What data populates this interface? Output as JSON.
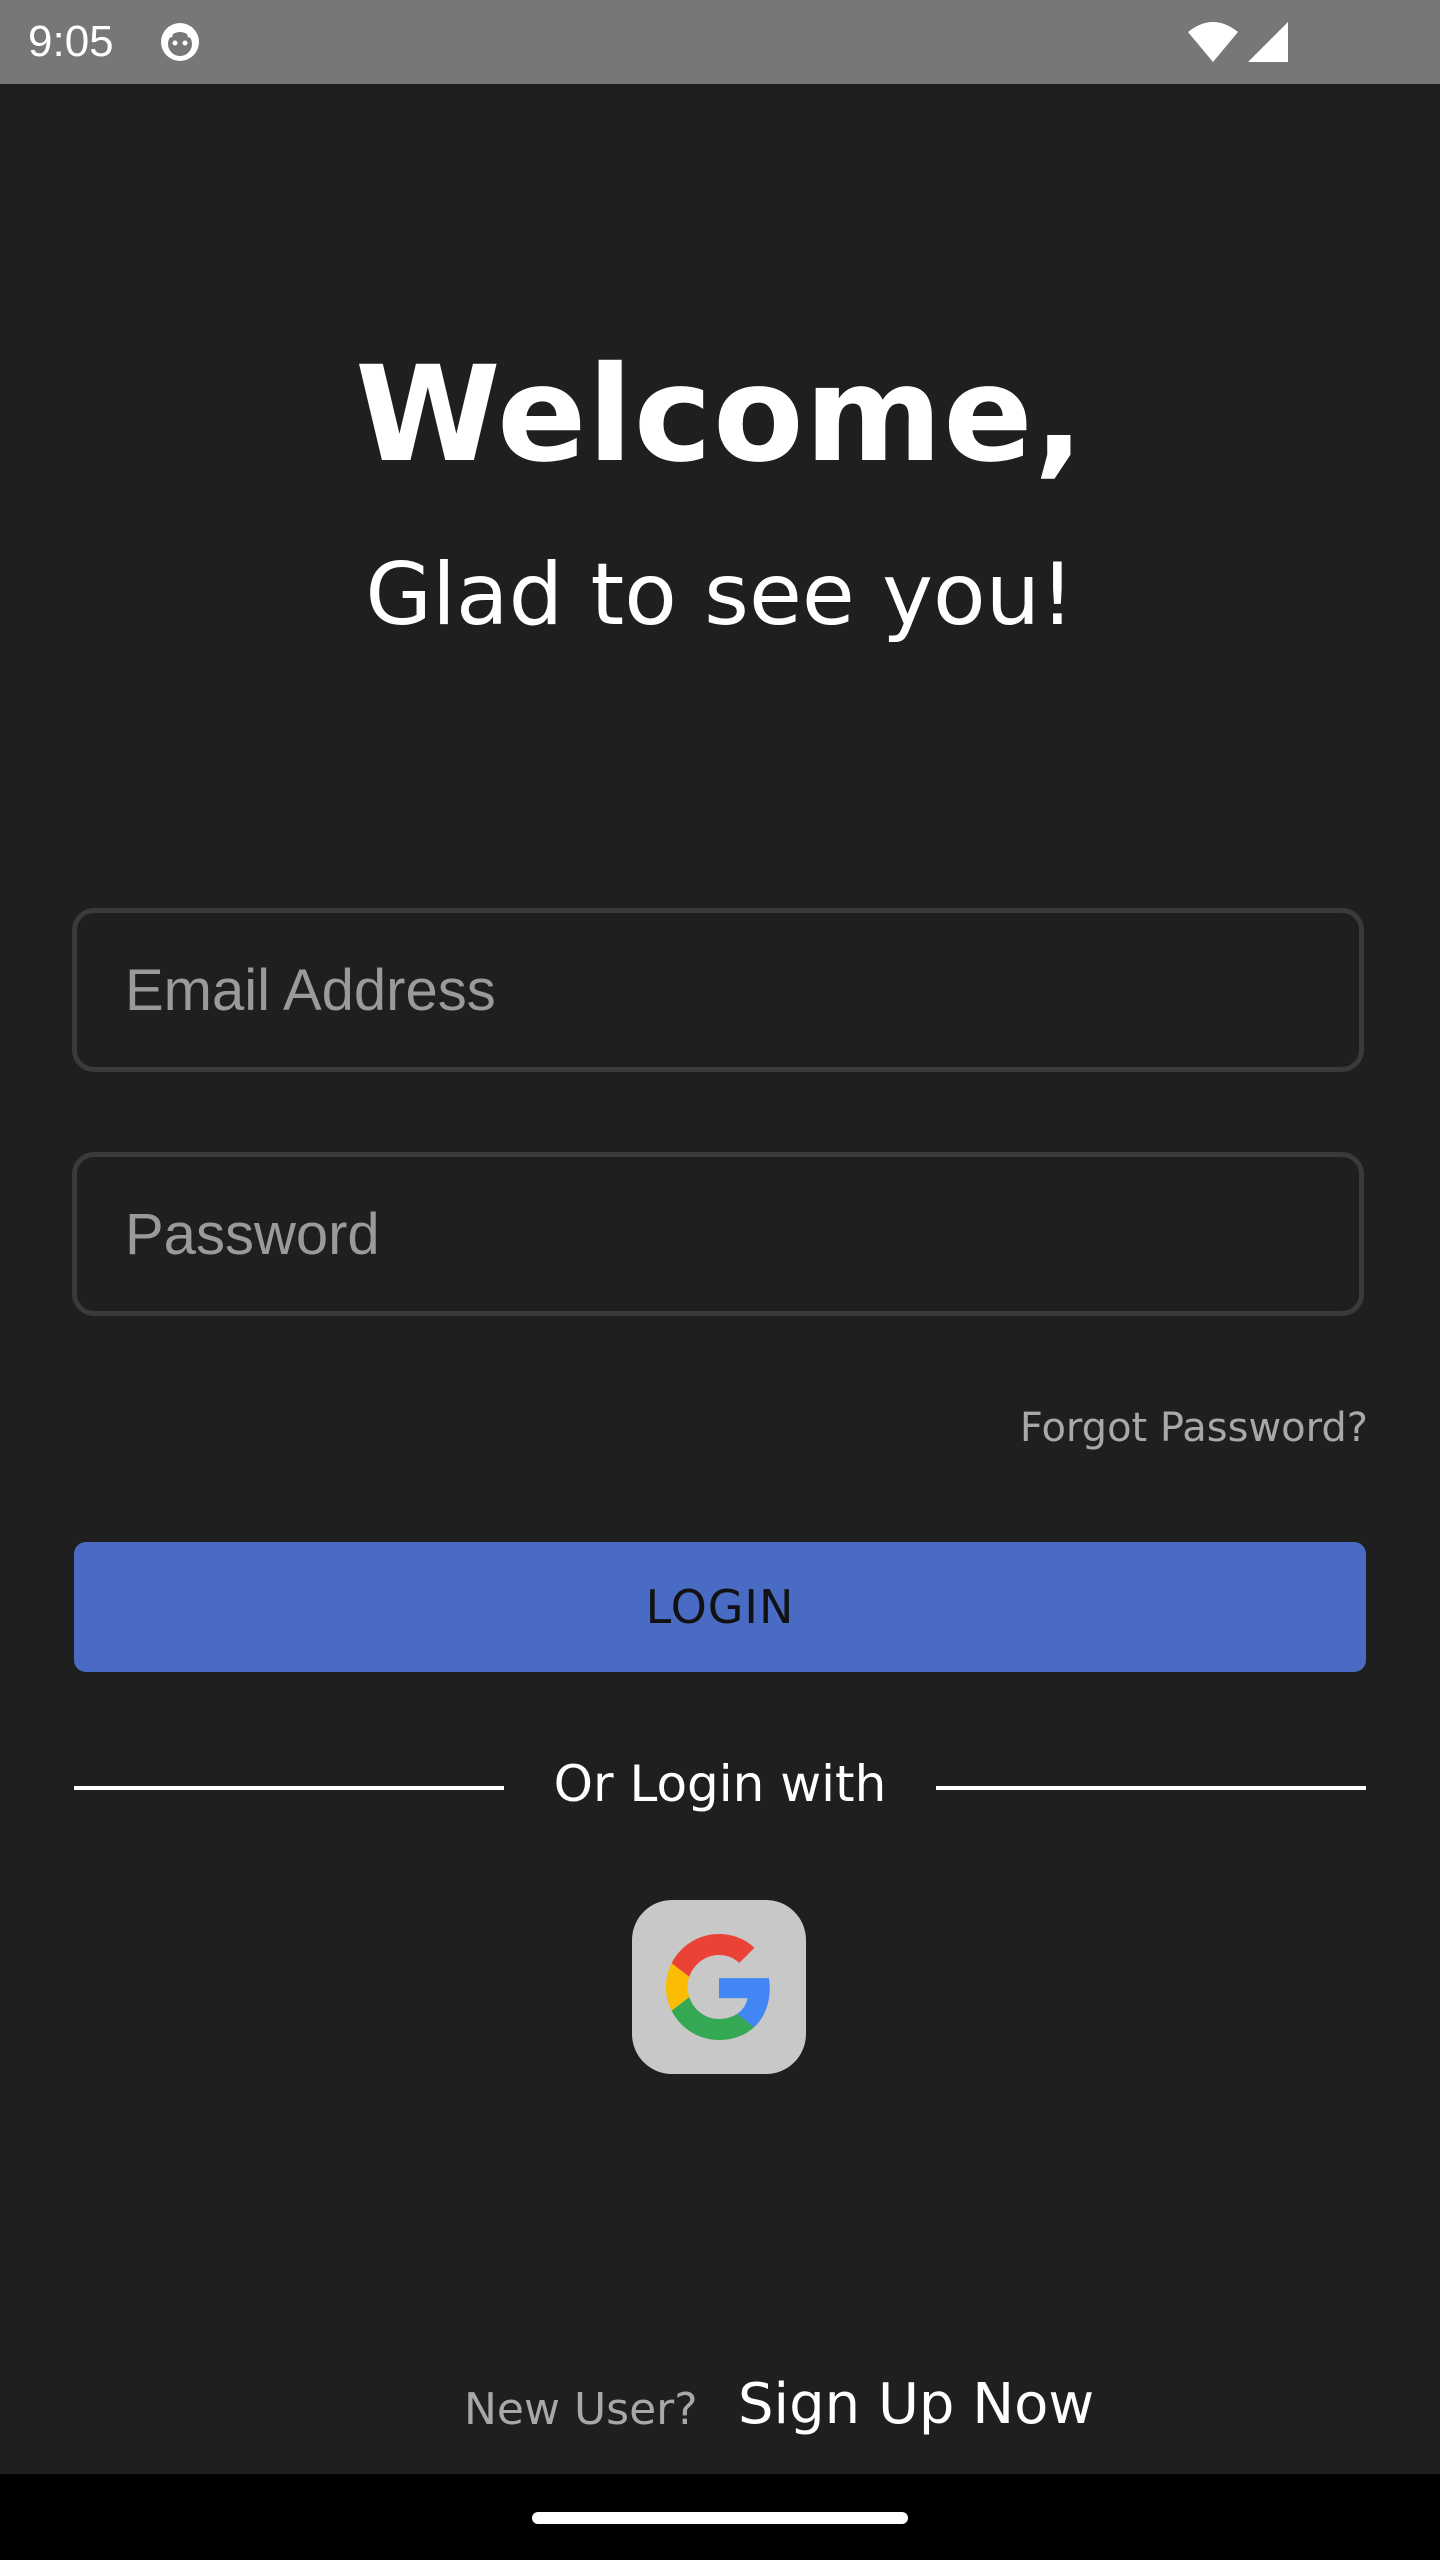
{
  "status_bar": {
    "time": "9:05",
    "app_icon": "app-notification-icon",
    "wifi_icon": "wifi-icon",
    "signal_icon": "cell-signal-icon"
  },
  "header": {
    "title": "Welcome,",
    "subtitle": "Glad to see you!"
  },
  "form": {
    "email_placeholder": "Email Address",
    "email_value": "",
    "password_placeholder": "Password",
    "password_value": "",
    "forgot_label": "Forgot Password?",
    "login_label": "LOGIN"
  },
  "divider": {
    "label": "Or Login with"
  },
  "social": {
    "google_icon": "google-icon"
  },
  "footer": {
    "new_user_label": "New User?",
    "signup_label": "Sign Up Now"
  },
  "colors": {
    "background": "#1f1f1f",
    "status_bar": "#777777",
    "accent": "#4a6bc3",
    "field_border": "#3a3a3a",
    "muted_text": "#a8a8a8"
  }
}
